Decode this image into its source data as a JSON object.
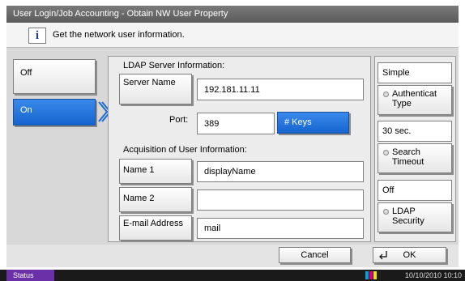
{
  "title": "User Login/Job Accounting - Obtain NW User Property",
  "info": {
    "icon": "info-icon",
    "glyph": "i",
    "text": "Get the network user information."
  },
  "left": {
    "off_label": "Off",
    "on_label": "On"
  },
  "ldap": {
    "section_label": "LDAP Server Information:",
    "server_name_label": "Server Name",
    "server_name_value": "192.181.11.11",
    "port_label": "Port:",
    "port_value": "389",
    "keys_label": "# Keys"
  },
  "acquisition": {
    "section_label": "Acquisition of User Information:",
    "name1_label": "Name 1",
    "name1_value": "displayName",
    "name2_label": "Name 2",
    "name2_value": "",
    "email_label": "E-mail Address",
    "email_value": "mail"
  },
  "right": {
    "auth_value": "Simple",
    "auth_button": "Authenticat Type",
    "timeout_value": "30",
    "timeout_unit": "sec.",
    "timeout_button": "Search Timeout",
    "security_value": "Off",
    "security_button": "LDAP Security"
  },
  "bottom": {
    "cancel_label": "Cancel",
    "ok_label": "OK"
  },
  "status": {
    "status_label": "Status",
    "datetime": "10/10/2010 10:10",
    "toner_colors": [
      "#00a0e0",
      "#e0007a",
      "#f5e000",
      "#202020"
    ]
  },
  "colors": {
    "accent": "#1a6ad8",
    "status_tab": "#6b2fa8"
  }
}
